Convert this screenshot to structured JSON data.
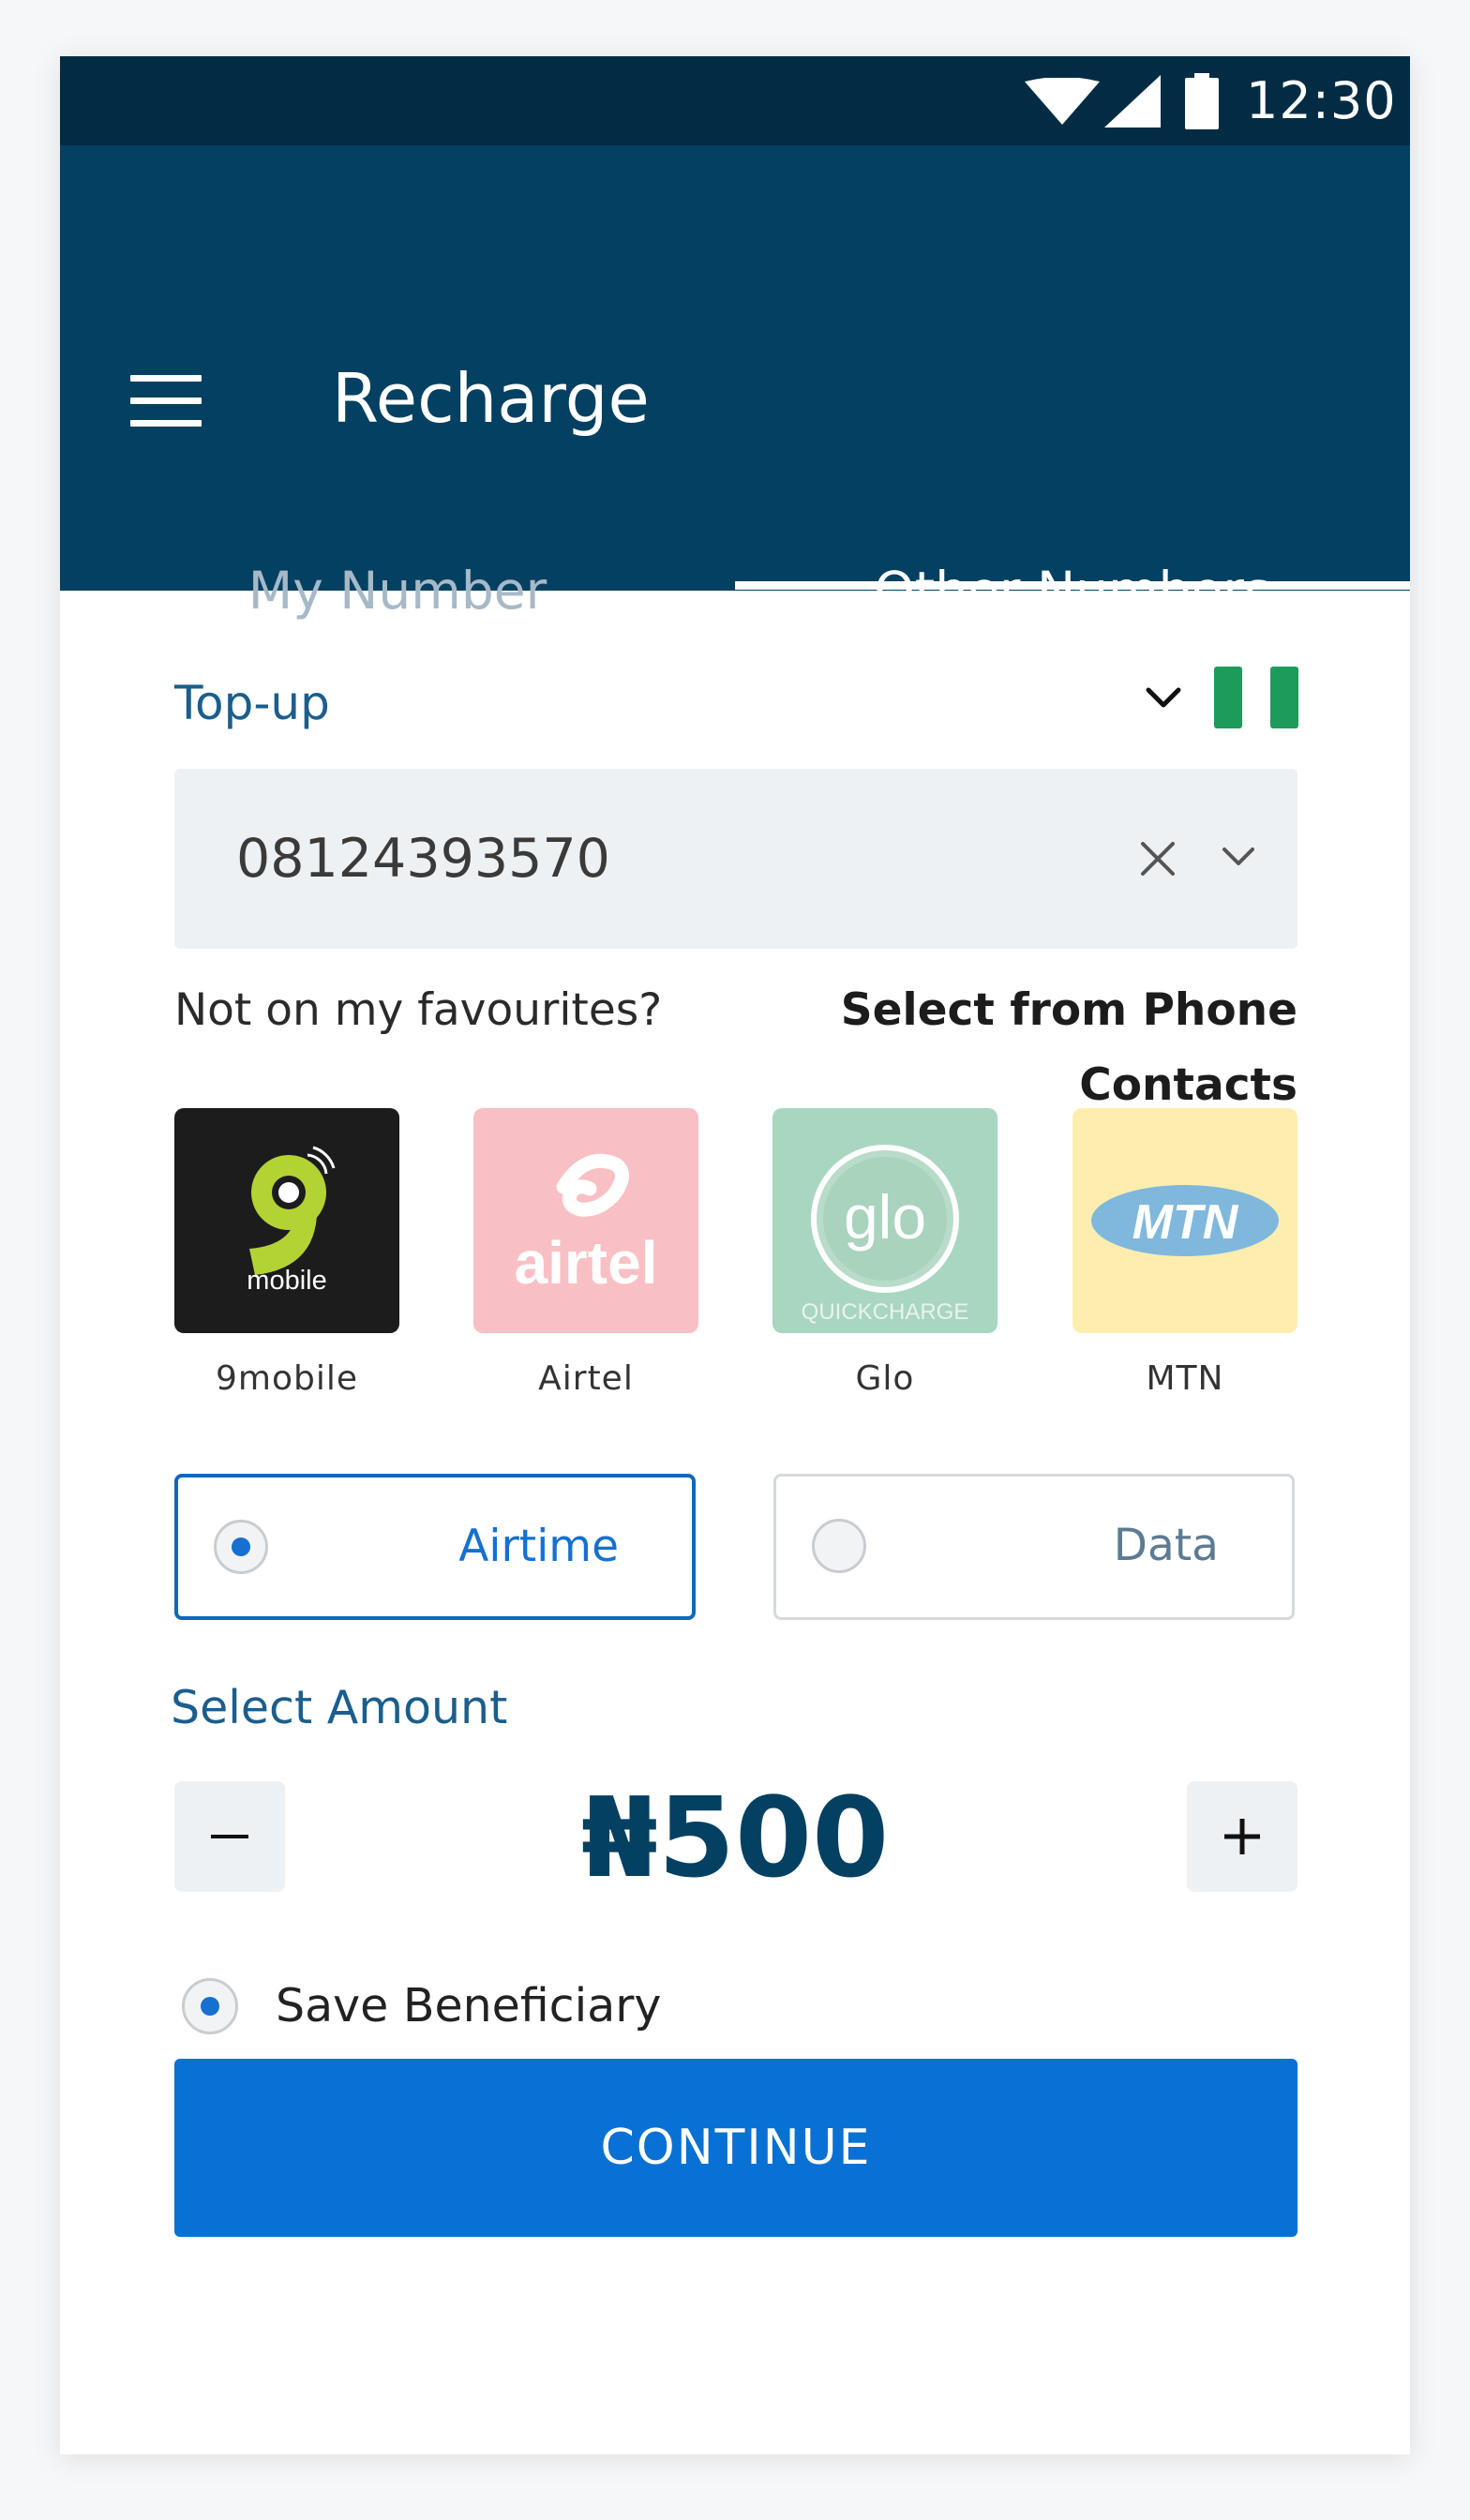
{
  "status_bar": {
    "time": "12:30",
    "icons": [
      "wifi-icon",
      "signal-icon",
      "battery-icon"
    ]
  },
  "app_bar": {
    "title": "Recharge",
    "menu_icon": "menu-icon"
  },
  "tabs": [
    {
      "label": "My Number",
      "active": false
    },
    {
      "label": "Other Numbers",
      "active": true
    }
  ],
  "topup": {
    "label": "Top-up",
    "country_flag": "nigeria-flag-icon",
    "phone_value": "08124393570",
    "clear_icon": "close-icon",
    "dropdown_icon": "chevron-down-icon"
  },
  "favourites": {
    "prompt": "Not on my favourites?",
    "link": "Select from Phone Contacts"
  },
  "operators": [
    {
      "name": "9mobile",
      "logo_text": "mobile",
      "selected": true,
      "color": "#1c1c1c"
    },
    {
      "name": "Airtel",
      "logo_text": "airtel",
      "selected": false,
      "color": "#f8c0c4"
    },
    {
      "name": "Glo",
      "logo_text": "glo",
      "logo_subtext": "QUICKCHARGE",
      "selected": false,
      "color": "#a9d6c0"
    },
    {
      "name": "MTN",
      "logo_text": "MTN",
      "selected": false,
      "color": "#fdeeb0"
    }
  ],
  "recharge_type": {
    "options": [
      {
        "label": "Airtime",
        "selected": true
      },
      {
        "label": "Data",
        "selected": false
      }
    ]
  },
  "amount": {
    "label": "Select Amount",
    "value": "₦500",
    "decrement_icon": "minus-icon",
    "increment_icon": "plus-icon"
  },
  "save_beneficiary": {
    "label": "Save Beneficiary",
    "checked": true
  },
  "continue_label": "CONTINUE",
  "colors": {
    "status_bar": "#022c43",
    "app_bar": "#034061",
    "primary": "#0971d3",
    "accent_text": "#1b5e8d"
  }
}
